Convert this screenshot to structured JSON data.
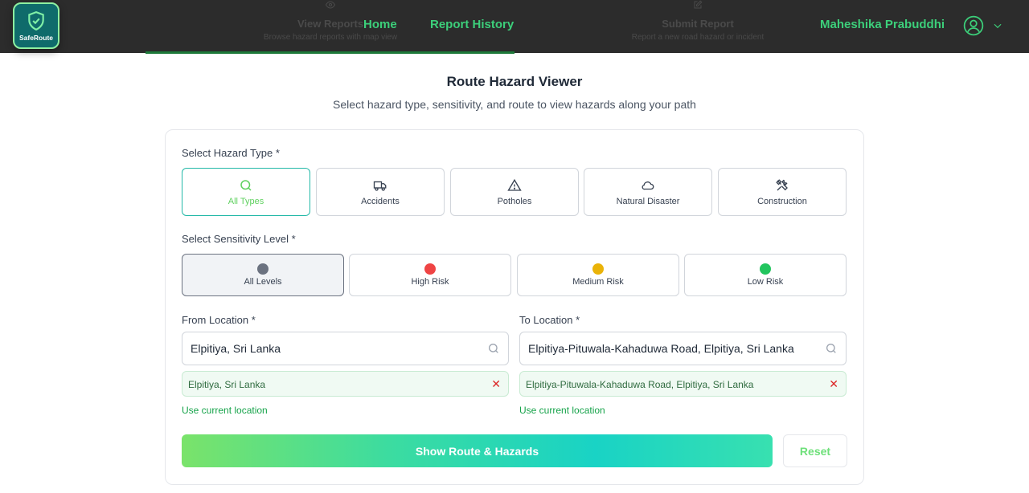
{
  "header": {
    "logo_text": "SafeRoute",
    "ghost_tabs": [
      {
        "title": "View Reports",
        "subtitle": "Browse hazard reports with map view",
        "icon": "eye-icon"
      },
      {
        "title": "Submit Report",
        "subtitle": "Report a new road hazard or incident",
        "icon": "edit-icon"
      }
    ],
    "nav": {
      "home": "Home",
      "report_history": "Report History"
    },
    "user_name": "Maheshika Prabuddhi"
  },
  "page": {
    "title": "Route Hazard Viewer",
    "subtitle": "Select hazard type, sensitivity, and route to view hazards along your path"
  },
  "hazard_types": {
    "label": "Select Hazard Type *",
    "items": [
      {
        "label": "All Types",
        "icon": "search-icon",
        "active": true
      },
      {
        "label": "Accidents",
        "icon": "truck-icon",
        "active": false
      },
      {
        "label": "Potholes",
        "icon": "warning-triangle-icon",
        "active": false
      },
      {
        "label": "Natural Disaster",
        "icon": "cloud-icon",
        "active": false
      },
      {
        "label": "Construction",
        "icon": "tools-icon",
        "active": false
      }
    ]
  },
  "sensitivity": {
    "label": "Select Sensitivity Level *",
    "items": [
      {
        "label": "All Levels",
        "color": "#6b7280",
        "active": true
      },
      {
        "label": "High Risk",
        "color": "#ef4444",
        "active": false
      },
      {
        "label": "Medium Risk",
        "color": "#eab308",
        "active": false
      },
      {
        "label": "Low Risk",
        "color": "#22c55e",
        "active": false
      }
    ]
  },
  "from": {
    "label": "From Location *",
    "value": "Elpitiya, Sri Lanka",
    "selected": "Elpitiya, Sri Lanka",
    "use_current": "Use current location"
  },
  "to": {
    "label": "To Location *",
    "value": "Elpitiya-Pituwala-Kahaduwa Road, Elpitiya, Sri Lanka",
    "selected": "Elpitiya-Pituwala-Kahaduwa Road, Elpitiya, Sri Lanka",
    "use_current": "Use current location"
  },
  "actions": {
    "show": "Show Route & Hazards",
    "reset": "Reset"
  },
  "colors": {
    "accent_green": "#3ccf7a",
    "header_bg": "#2c2c2c",
    "active_border": "#22b8a7"
  }
}
